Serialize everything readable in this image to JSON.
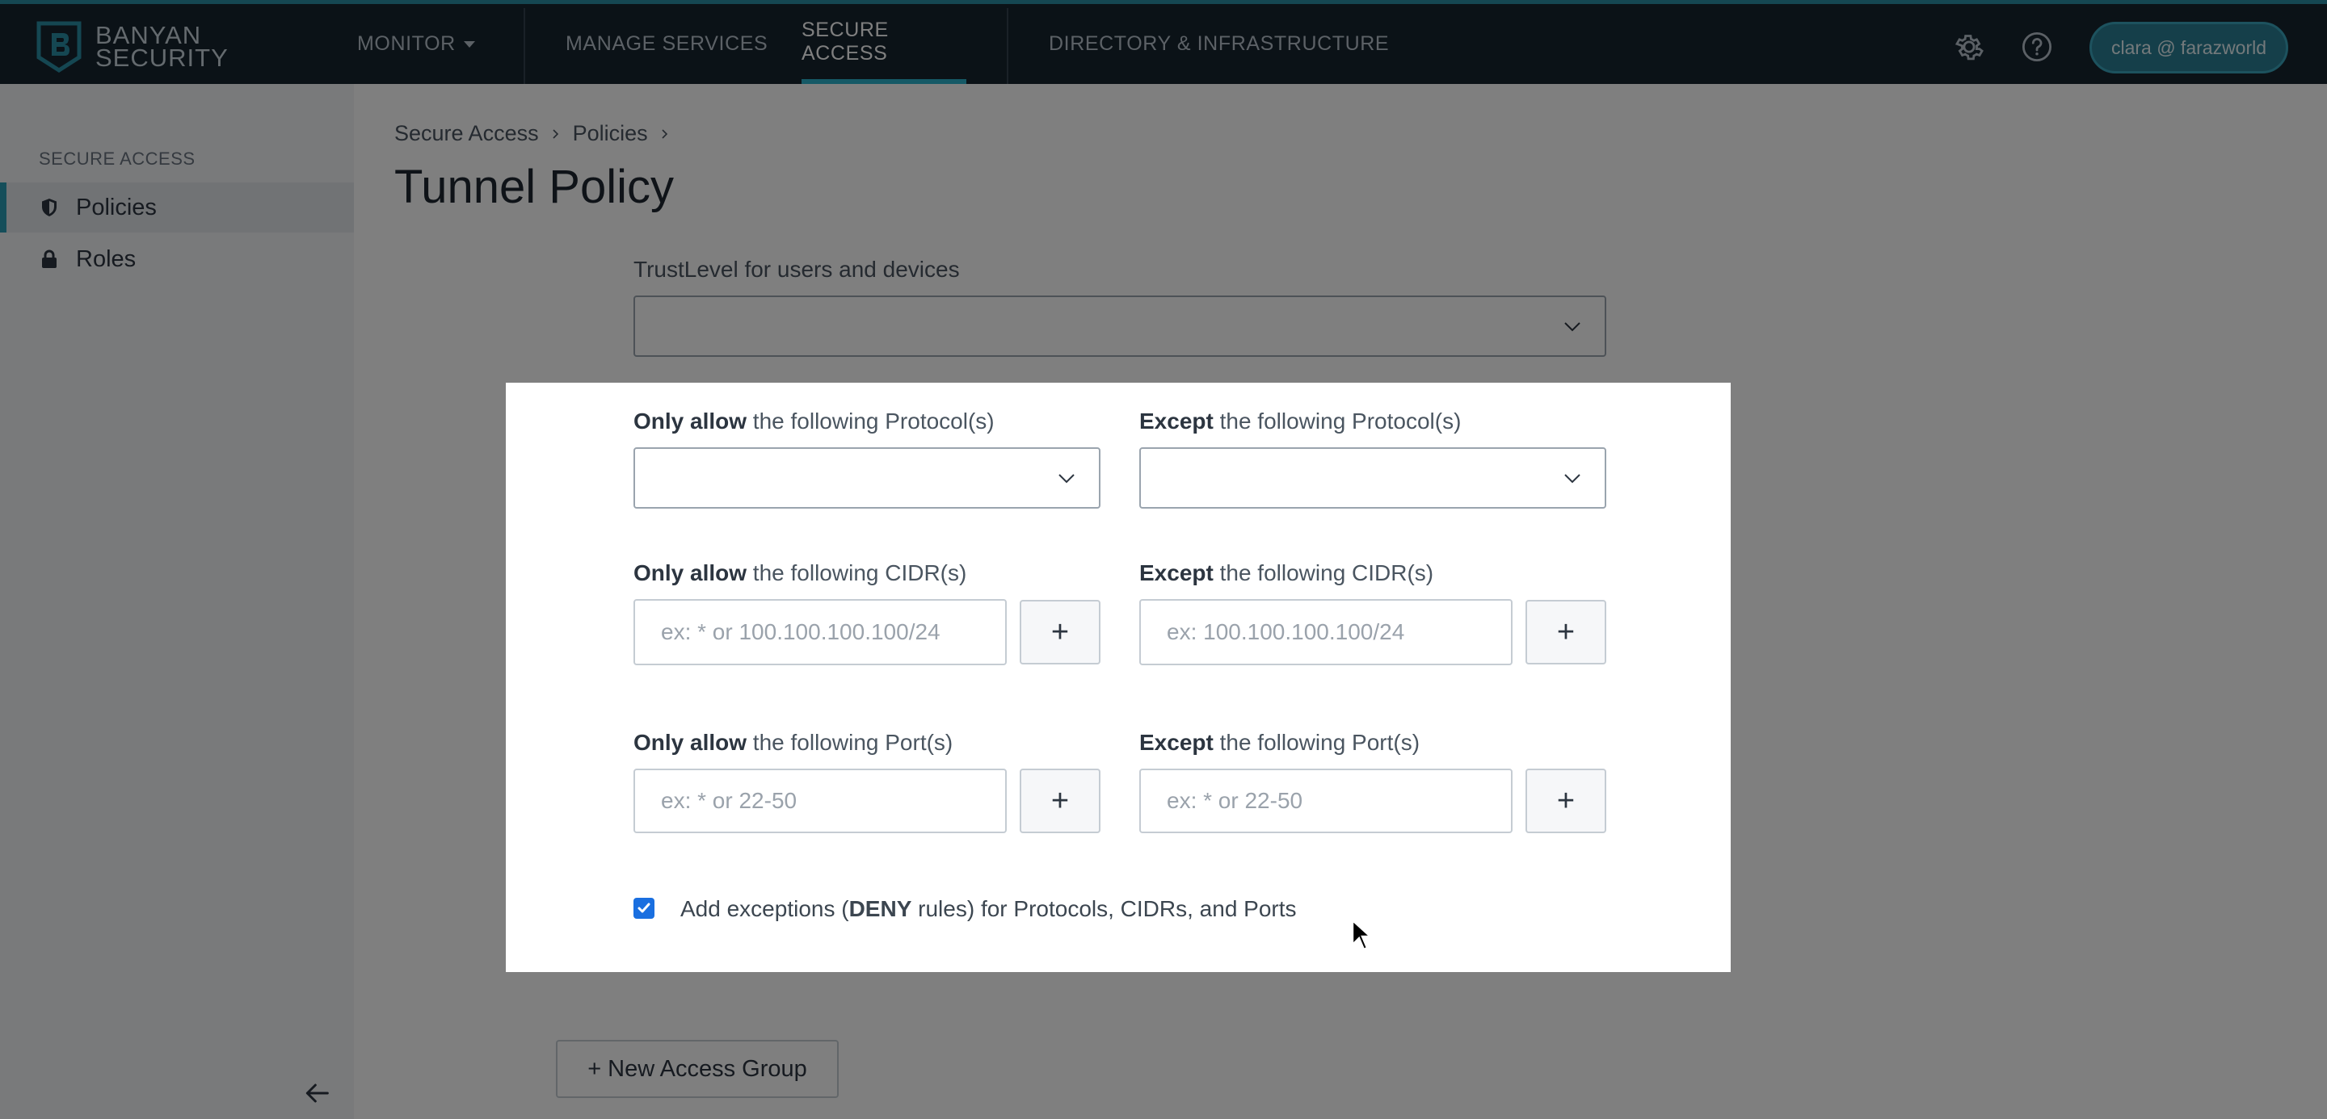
{
  "topbar": {
    "logo_line1": "BANYAN",
    "logo_line2": "SECURITY",
    "nav": [
      {
        "label": "MONITOR"
      },
      {
        "label": "MANAGE SERVICES"
      },
      {
        "label": "SECURE ACCESS"
      },
      {
        "label": "DIRECTORY & INFRASTRUCTURE"
      }
    ],
    "user": "clara @ farazworld"
  },
  "sidebar": {
    "section": "SECURE ACCESS",
    "items": [
      {
        "label": "Policies",
        "icon": "shield-icon"
      },
      {
        "label": "Roles",
        "icon": "lock-icon"
      }
    ]
  },
  "breadcrumb": [
    "Secure Access",
    "Policies"
  ],
  "page_title": "Tunnel Policy",
  "trustlevel": {
    "label": "TrustLevel for users and devices"
  },
  "modal": {
    "protocols_allow": {
      "bold": "Only allow",
      "rest": " the following Protocol(s)"
    },
    "protocols_except": {
      "bold": "Except",
      "rest": " the following Protocol(s)"
    },
    "cidrs_allow": {
      "bold": "Only allow",
      "rest": " the following CIDR(s)",
      "placeholder": "ex: * or 100.100.100.100/24"
    },
    "cidrs_except": {
      "bold": "Except",
      "rest": " the following CIDR(s)",
      "placeholder": "ex: 100.100.100.100/24"
    },
    "ports_allow": {
      "bold": "Only allow",
      "rest": " the following Port(s)",
      "placeholder": "ex: * or 22-50"
    },
    "ports_except": {
      "bold": "Except",
      "rest": " the following Port(s)",
      "placeholder": "ex: * or 22-50"
    },
    "plus": "+",
    "exceptions": {
      "pre": "Add exceptions (",
      "bold": "DENY",
      "post": " rules) for Protocols, CIDRs, and Ports",
      "checked": true
    }
  },
  "new_access_group": {
    "plus": "+",
    "label": "New Access Group"
  },
  "colors": {
    "accent": "#2ab3cc",
    "topbar": "#16242f",
    "checkbox": "#1a6fe0"
  }
}
